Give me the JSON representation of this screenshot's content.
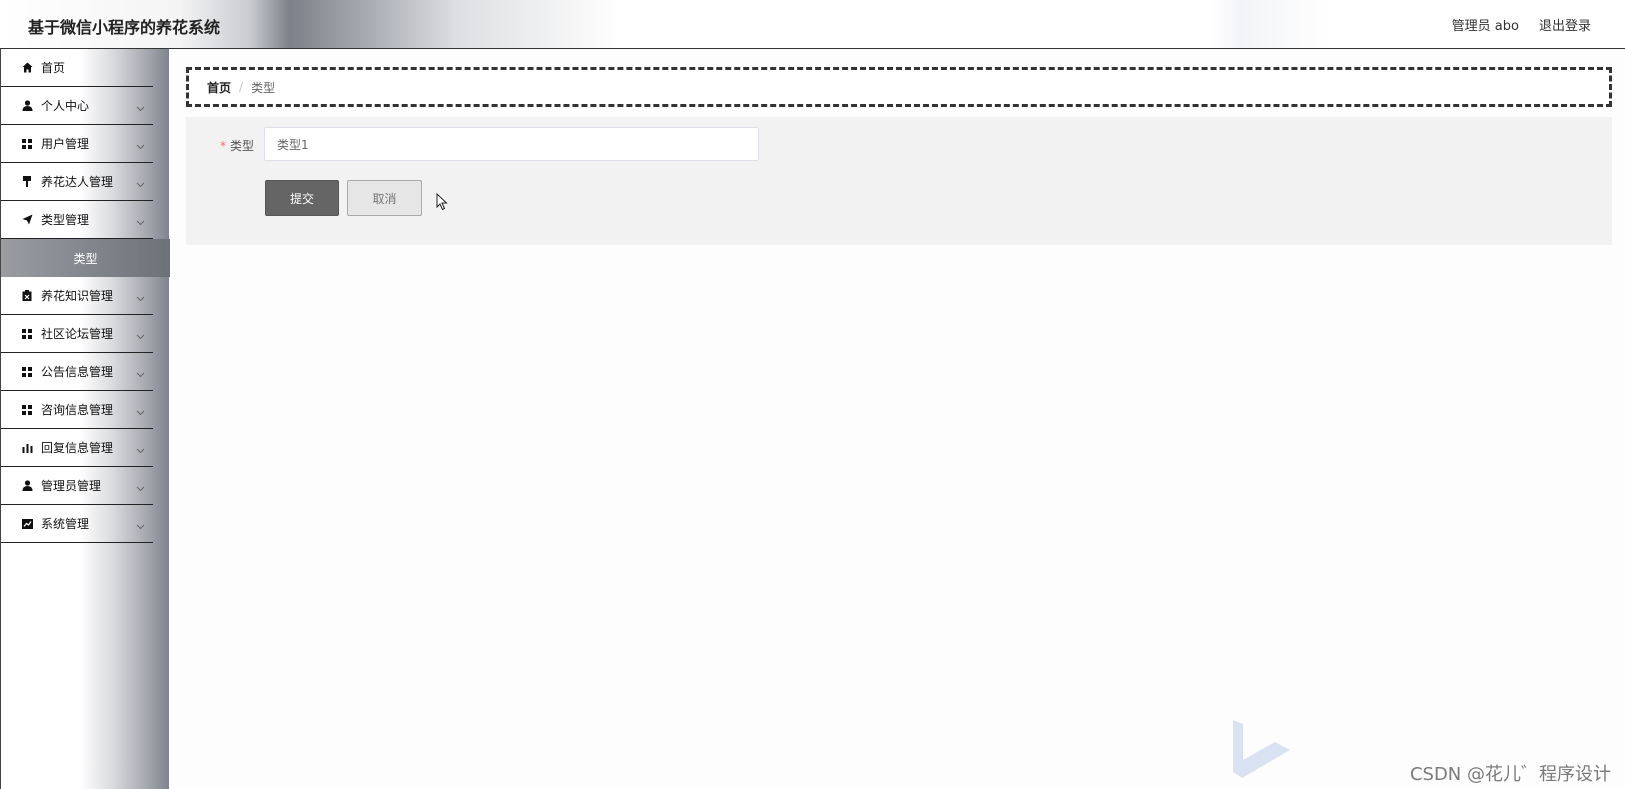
{
  "header": {
    "title": "基于微信小程序的养花系统",
    "user": "管理员 abo",
    "logout": "退出登录"
  },
  "sidebar": {
    "items": [
      {
        "label": "首页",
        "icon": "home-icon",
        "chevron": false
      },
      {
        "label": "个人中心",
        "icon": "user-icon",
        "chevron": true
      },
      {
        "label": "用户管理",
        "icon": "grid-icon",
        "chevron": true
      },
      {
        "label": "养花达人管理",
        "icon": "brush-icon",
        "chevron": true
      },
      {
        "label": "类型管理",
        "icon": "send-icon",
        "chevron": true
      },
      {
        "label": "类型",
        "icon": "",
        "chevron": false,
        "active": true
      },
      {
        "label": "养花知识管理",
        "icon": "clipboard-icon",
        "chevron": true
      },
      {
        "label": "社区论坛管理",
        "icon": "grid-icon",
        "chevron": true
      },
      {
        "label": "公告信息管理",
        "icon": "grid-icon",
        "chevron": true
      },
      {
        "label": "咨询信息管理",
        "icon": "grid-icon",
        "chevron": true
      },
      {
        "label": "回复信息管理",
        "icon": "bar-chart-icon",
        "chevron": true
      },
      {
        "label": "管理员管理",
        "icon": "user-icon",
        "chevron": true
      },
      {
        "label": "系统管理",
        "icon": "line-chart-icon",
        "chevron": true
      }
    ]
  },
  "breadcrumb": {
    "home": "首页",
    "separator": "/",
    "current": "类型"
  },
  "form": {
    "required_mark": "*",
    "type_label": "类型",
    "type_value": "类型1",
    "submit": "提交",
    "cancel": "取消"
  },
  "watermark": {
    "text": "CSDN @花儿゛程序设计"
  },
  "colors": {
    "accent": "#656565",
    "required": "#f56c6c"
  }
}
